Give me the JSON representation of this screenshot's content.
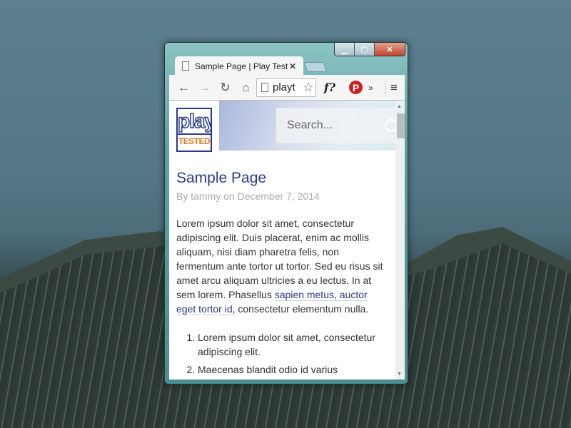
{
  "window": {
    "minimize": "▁",
    "maximize": "▢",
    "close": "✕"
  },
  "tab": {
    "title": "Sample Page | Play Test",
    "close": "✕"
  },
  "toolbar": {
    "back": "←",
    "forward": "→",
    "reload": "↻",
    "home": "⌂",
    "url": "playt",
    "star": "☆",
    "fq": "f?",
    "pinterest": "P",
    "overflow": "»",
    "menu": "≡"
  },
  "site": {
    "logo_top": "play",
    "logo_bottom": "TESTED",
    "search_placeholder": "Search..."
  },
  "article": {
    "title": "Sample Page",
    "meta": "By tammy on December 7, 2014",
    "para_before": "Lorem ipsum dolor sit amet, consectetur adipiscing elit. Duis placerat, enim ac mollis aliquam, nisi diam pharetra felis, non fermentum ante tortor ut tortor. Sed eu risus sit amet arcu aliquam ultricies a eu lectus. In at sem lorem. Phasellus ",
    "link": "sapien metus, auctor eget tortor id",
    "para_after": ", consectetur elementum nulla.",
    "list": [
      "Lorem ipsum dolor sit amet, consectetur adipiscing elit.",
      "Maecenas blandit odio id varius"
    ]
  },
  "colors": {
    "accent": "#2b3a8c",
    "logo_orange": "#e07a20",
    "pinterest": "#cb2027"
  }
}
